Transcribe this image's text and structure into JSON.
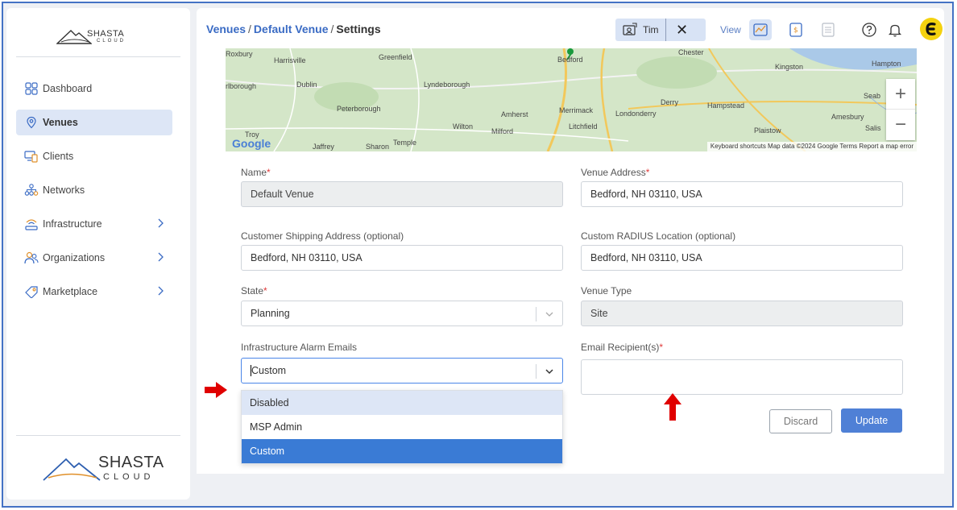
{
  "sidebar": {
    "logo_top": {
      "brand": "SHASTA",
      "sub": "CLOUD"
    },
    "items": [
      {
        "label": "Dashboard",
        "icon": "dashboard-grid-icon"
      },
      {
        "label": "Venues",
        "icon": "location-pin-icon",
        "active": true
      },
      {
        "label": "Clients",
        "icon": "devices-icon"
      },
      {
        "label": "Networks",
        "icon": "network-tree-icon"
      },
      {
        "label": "Infrastructure",
        "icon": "access-point-icon",
        "expandable": true
      },
      {
        "label": "Organizations",
        "icon": "users-icon",
        "expandable": true
      },
      {
        "label": "Marketplace",
        "icon": "tag-icon",
        "expandable": true
      }
    ],
    "logo_bottom": {
      "brand": "SHASTA",
      "sub": "CLOUD"
    }
  },
  "header": {
    "breadcrumb": {
      "part1": "Venues",
      "sep1": "/",
      "part2": "Default Venue",
      "sep2": "/",
      "part3": "Settings"
    },
    "impersonation": {
      "user": "Tim",
      "close": "✕"
    },
    "view_label": "View",
    "icons": [
      "map-view-icon",
      "report-view-icon",
      "table-view-icon",
      "help-icon",
      "bell-icon",
      "avatar"
    ]
  },
  "map": {
    "labels": [
      "Roxbury",
      "Harrisville",
      "Greenfield",
      "Bedford",
      "Chester",
      "Kingston",
      "Hampton",
      "Dublin",
      "Lyndeborough",
      "rlborough",
      "Peterborough",
      "Amherst",
      "Merrimack",
      "Londonderry",
      "Derry",
      "Hampstead",
      "Seab",
      "Amesbury",
      "Wilton",
      "Milford",
      "Litchfield",
      "Plaistow",
      "Salis",
      "Troy",
      "Jaffrey",
      "Sharon",
      "Temple"
    ],
    "google": "Google",
    "attribution": "Keyboard shortcuts   Map data ©2024 Google   Terms   Report a map error",
    "zoom_in": "+",
    "zoom_out": "−"
  },
  "form": {
    "name": {
      "label": "Name",
      "value": "Default Venue"
    },
    "venue_address": {
      "label": "Venue Address",
      "value": "Bedford, NH 03110, USA"
    },
    "shipping": {
      "label": "Customer Shipping Address (optional)",
      "value": "Bedford, NH 03110, USA"
    },
    "radius": {
      "label": "Custom RADIUS Location (optional)",
      "value": "Bedford, NH 03110, USA"
    },
    "state": {
      "label": "State",
      "value": "Planning"
    },
    "venue_type": {
      "label": "Venue Type",
      "value": "Site"
    },
    "alarm_emails": {
      "label": "Infrastructure Alarm Emails",
      "value": "Custom",
      "options": [
        "Disabled",
        "MSP Admin",
        "Custom"
      ]
    },
    "recipients": {
      "label": "Email Recipient(s)",
      "value": ""
    },
    "required_mark": "*",
    "discard": "Discard",
    "update": "Update"
  },
  "colors": {
    "accent": "#4f80d6",
    "required": "#e03a3a",
    "annotation_arrow": "#e00000",
    "frame": "#4472c4"
  }
}
